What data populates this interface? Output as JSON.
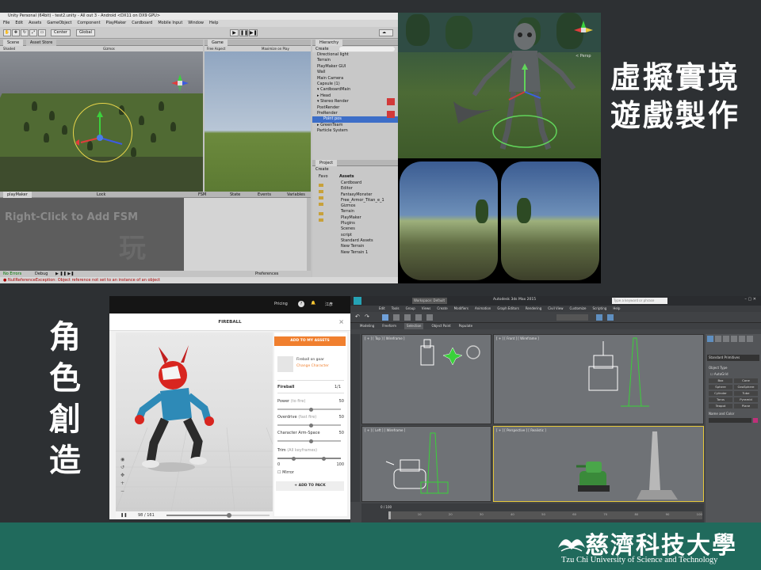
{
  "captions": {
    "vr_game": [
      "虛擬實境",
      "遊戲製作"
    ],
    "character": [
      "角",
      "色",
      "創",
      "造"
    ]
  },
  "unity": {
    "title": "Unity Personal (64bit) - test2.unity - All out 3 - Android <DX11 on DX9 GPU>",
    "menu": [
      "File",
      "Edit",
      "Assets",
      "GameObject",
      "Component",
      "PlayMaker",
      "Cardboard",
      "Mobile Input",
      "Window",
      "Help"
    ],
    "toolbar": {
      "center": "Center",
      "global": "Global"
    },
    "tabs": {
      "scene": "Scene",
      "asset_store": "Asset Store",
      "game": "Game",
      "hierarchy": "Hierarchy",
      "project": "Project"
    },
    "scene_bar": {
      "shaded": "Shaded",
      "gizmos": "Gizmos"
    },
    "game_bar": {
      "free_aspect": "Free Aspect",
      "maximize": "Maximize on Play"
    },
    "hierarchy": [
      {
        "label": "Directional light",
        "selected": false
      },
      {
        "label": "Terrain",
        "selected": false
      },
      {
        "label": "PlayMaker GUI",
        "selected": false
      },
      {
        "label": "Wall",
        "selected": false
      },
      {
        "label": "Main Camera",
        "selected": false
      },
      {
        "label": "Capsule (1)",
        "selected": false
      },
      {
        "label": "▾ CardboardMain",
        "selected": false
      },
      {
        "label": "  ▸ Head",
        "selected": false
      },
      {
        "label": "    ▾ Stereo Render",
        "selected": false
      },
      {
        "label": "        PostRender",
        "selected": false
      },
      {
        "label": "        PreRender",
        "selected": false
      },
      {
        "label": "Point pos",
        "selected": true
      },
      {
        "label": "▸ GreenTeam",
        "selected": false
      },
      {
        "label": "Particle System",
        "selected": false
      }
    ],
    "project_folders": [
      "Cardboard",
      "Editor",
      "FantasyMonster",
      "Free_Armor_Titan_e_1",
      "Gizmos",
      "Terrain",
      "PlayMaker",
      "Plugins",
      "Scenes",
      "script",
      "Standard Assets",
      "New Terrain",
      "New Terrain 1"
    ],
    "project_labels": {
      "create": "Create",
      "favorites": "Favo",
      "assets": "Assets"
    },
    "fsm_panel": {
      "tab": "playMaker",
      "hint": "Right-Click to Add FSM",
      "columns": [
        "FSM",
        "State",
        "Events",
        "Variables"
      ],
      "lock": "Lock",
      "preferences": "Preferences"
    },
    "playbar": {
      "none": "No Errors",
      "debug": "Debug"
    },
    "status": "NullReferenceException: Object reference not set to an instance of an object"
  },
  "vr": {
    "persp_label": "< Persp"
  },
  "mixamo": {
    "nav": {
      "pricing": "Pricing",
      "help": "?",
      "user": "江彥"
    },
    "animation_title": "FIREBALL",
    "close": "×",
    "add_to_assets": "ADD TO MY ASSETS",
    "character": {
      "name": "Fireball on goar",
      "change": "Change Character"
    },
    "panel_title": "Fireball",
    "panel_value": "1/1",
    "sliders": [
      {
        "label": "Power",
        "hint": "(to fire)",
        "value": "50",
        "pos": 0.5
      },
      {
        "label": "Overdrive",
        "hint": "(fast fire)",
        "value": "50",
        "pos": 0.5
      },
      {
        "label": "Character Arm-Space",
        "hint": "",
        "value": "50",
        "pos": 0.5
      }
    ],
    "trim": {
      "label": "Trim",
      "hint": "(All keyframes)",
      "min": "0",
      "max": "100"
    },
    "mirror": "Mirror",
    "add_to_pack": "+ ADD TO PACK",
    "timeline": {
      "frame": "98 / 161",
      "progress": 0.61
    }
  },
  "max": {
    "title": "Autodesk 3ds Max 2015",
    "workspace": "Workspace: Default",
    "search_placeholder": "Type a keyword or phrase",
    "menu": [
      "Edit",
      "Tools",
      "Group",
      "Views",
      "Create",
      "Modifiers",
      "Animation",
      "Graph Editors",
      "Rendering",
      "Civil View",
      "Customize",
      "Scripting",
      "Help"
    ],
    "ribbon_tabs": [
      "Modeling",
      "Freeform",
      "Selection",
      "Object Paint",
      "Populate"
    ],
    "viewports": [
      {
        "label": "[ + ] [ Top ] [ Wireframe ]"
      },
      {
        "label": "[ + ] [ Front ] [ Wireframe ]"
      },
      {
        "label": "[ + ] [ Left ] [ Wireframe ]"
      },
      {
        "label": "[ + ] [ Perspective ] [ Realistic ]"
      }
    ],
    "cmd_panel": {
      "dropdown": "Standard Primitives",
      "section": "Object Type",
      "autogrid": "AutoGrid",
      "primitives": [
        "Box",
        "Cone",
        "Sphere",
        "GeoSphere",
        "Cylinder",
        "Tube",
        "Torus",
        "Pyramid",
        "Teapot",
        "Plane"
      ],
      "name_color": "Name and Color"
    },
    "timeline": {
      "frame": "0 / 100",
      "ticks": [
        "0",
        "10",
        "20",
        "30",
        "40",
        "50",
        "60",
        "70",
        "80",
        "90",
        "100"
      ]
    }
  },
  "footer": {
    "name_zh": "慈濟科技大學",
    "name_en": "Tzu Chi University of Science and Technology",
    "color": "#206a5c"
  }
}
